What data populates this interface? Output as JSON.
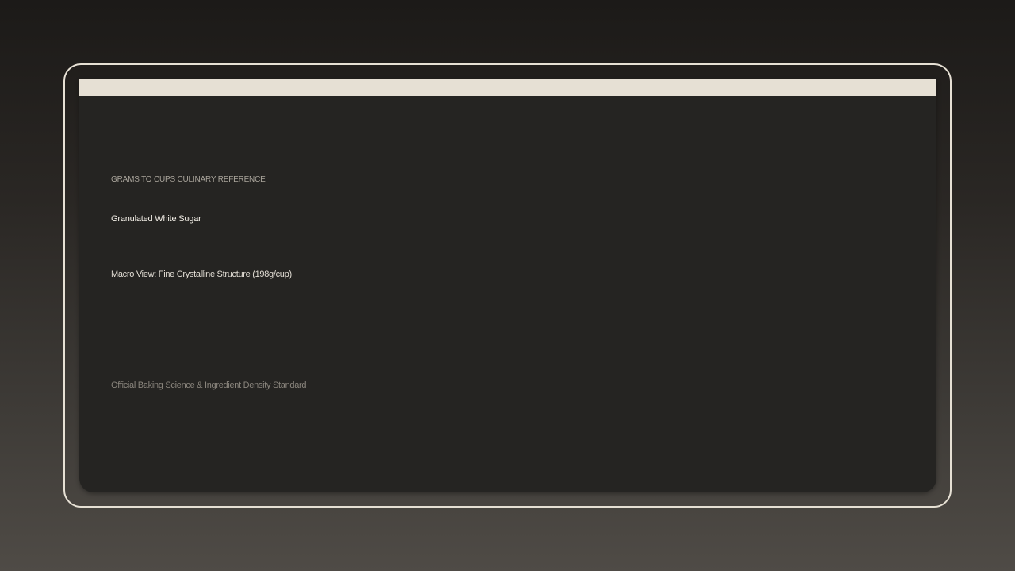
{
  "card": {
    "kicker": "GRAMS TO CUPS CULINARY REFERENCE",
    "title": "Granulated White Sugar",
    "image_caption": "Macro View: Fine Crystalline Structure (198g/cup)",
    "footer": "Official Baking Science & Ingredient Density Standard"
  },
  "colors": {
    "frame_border": "#e6e0d4",
    "panel_background": "#252422",
    "top_bar": "#e6e0d4",
    "kicker_text": "#a9a49b",
    "title_text": "#f2eee6",
    "footer_text": "#8b867e"
  }
}
